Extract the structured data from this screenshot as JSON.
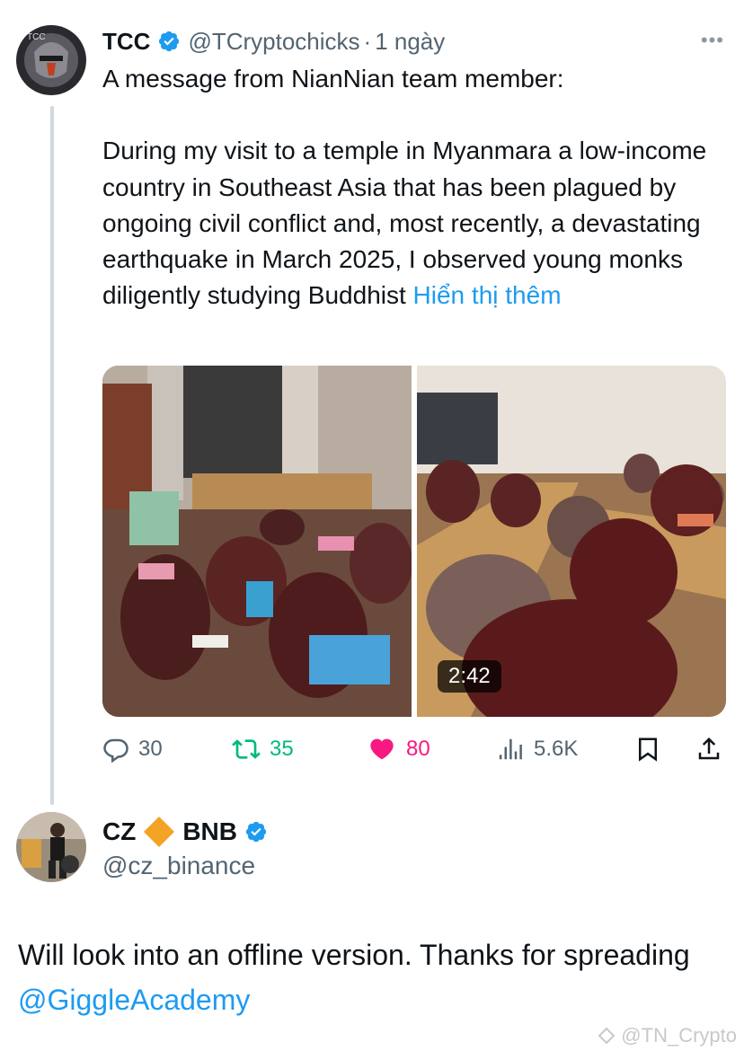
{
  "tweet1": {
    "display_name": "TCC",
    "handle": "@TCryptochicks",
    "separator": "·",
    "time": "1 ngày",
    "more_label": "•••",
    "text_line1": "A message from NianNian team member:",
    "text_para2": "During my visit to a temple in Myanmara a low-income country in Southeast Asia that has been plagued by ongoing civil conflict and, most recently, a devastating earthquake in March 2025, I observed young monks diligently studying Buddhist",
    "show_more": "Hiển thị thêm",
    "video_duration": "2:42",
    "stats": {
      "replies": "30",
      "retweets": "35",
      "likes": "80",
      "views": "5.6K"
    },
    "icons": [
      "reply-icon",
      "retweet-icon",
      "heart-icon",
      "views-icon",
      "bookmark-icon",
      "share-icon",
      "verified-badge-icon"
    ],
    "colors": {
      "retweet": "#00ba7c",
      "like": "#f91880",
      "link": "#1d9bf0",
      "muted": "#536471"
    }
  },
  "tweet2": {
    "name_part1": "CZ",
    "name_part2": "BNB",
    "handle": "@cz_binance",
    "text_prefix": "Will look into an offline version. Thanks for spreading ",
    "mention": "@GiggleAcademy",
    "icons": [
      "bnb-diamond-icon",
      "verified-badge-icon"
    ]
  },
  "watermark": {
    "text": "@TN_Crypto"
  }
}
